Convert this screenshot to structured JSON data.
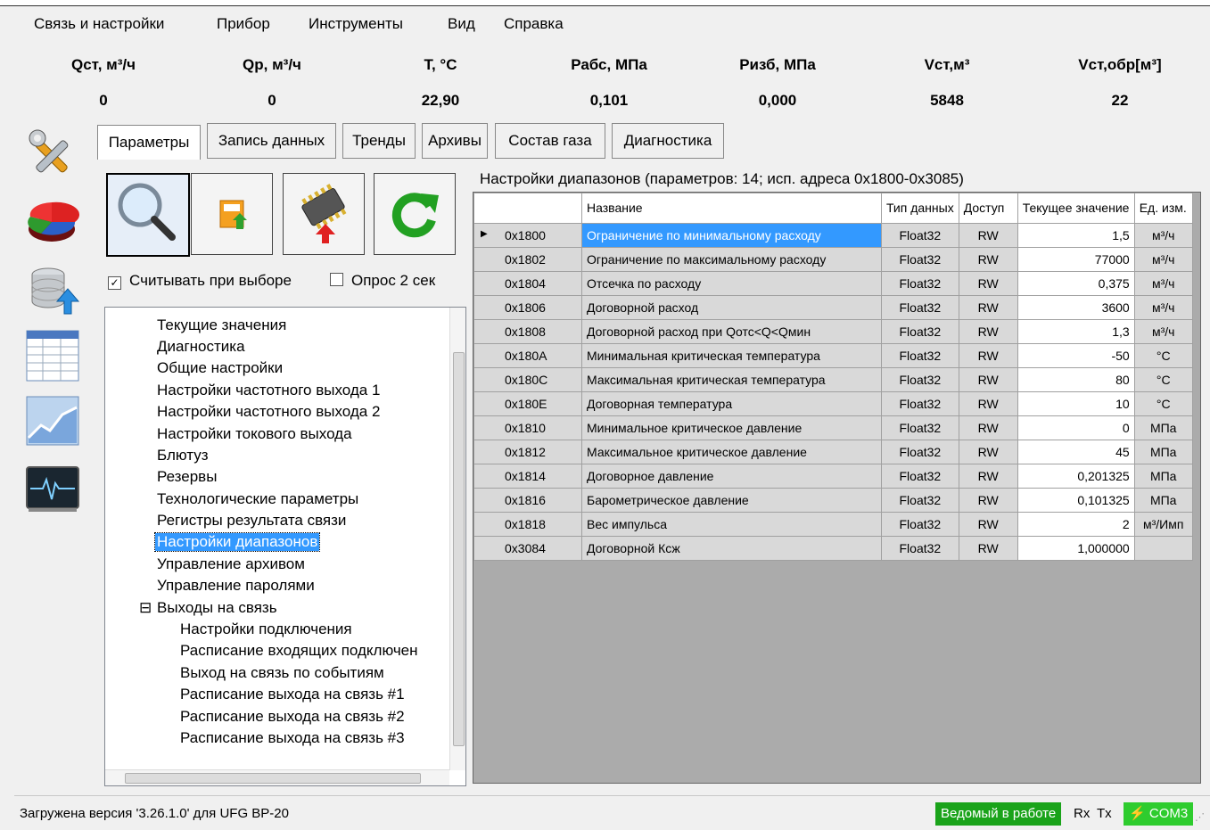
{
  "menu": [
    "Связь и настройки",
    "Прибор",
    "Инструменты",
    "Вид",
    "Справка"
  ],
  "readings": [
    {
      "label": "Qст, м³/ч",
      "value": "0"
    },
    {
      "label": "Qр, м³/ч",
      "value": "0"
    },
    {
      "label": "T, °C",
      "value": "22,90"
    },
    {
      "label": "Рабс, МПа",
      "value": "0,101"
    },
    {
      "label": "Ризб, МПа",
      "value": "0,000"
    },
    {
      "label": "Vст,м³",
      "value": "5848"
    },
    {
      "label": "Vст,обр[м³]",
      "value": "22"
    }
  ],
  "side_icons": [
    "tools-icon",
    "pie-chart-icon",
    "database-upload-icon",
    "table-icon",
    "line-chart-icon",
    "monitor-pulse-icon"
  ],
  "tabs": [
    "Параметры",
    "Запись данных",
    "Тренды",
    "Архивы",
    "Состав газа",
    "Диагностика"
  ],
  "toolbar": {
    "search": "search-icon",
    "save": "save-icon",
    "write_chip": "chip-write-icon",
    "refresh": "refresh-icon"
  },
  "checkboxes": {
    "read_on_select": {
      "label": "Считывать при выборе",
      "checked": true
    },
    "poll": {
      "label": "Опрос 2 сек",
      "checked": false
    }
  },
  "tree": [
    {
      "label": "Текущие значения",
      "level": 1
    },
    {
      "label": "Диагностика",
      "level": 1
    },
    {
      "label": "Общие настройки",
      "level": 1
    },
    {
      "label": "Настройки частотного выхода 1",
      "level": 1
    },
    {
      "label": "Настройки частотного выхода 2",
      "level": 1
    },
    {
      "label": "Настройки токового выхода",
      "level": 1
    },
    {
      "label": "Блютуз",
      "level": 1
    },
    {
      "label": "Резервы",
      "level": 1
    },
    {
      "label": "Технологические параметры",
      "level": 1
    },
    {
      "label": "Регистры результата связи",
      "level": 1
    },
    {
      "label": "Настройки диапазонов",
      "level": 1,
      "selected": true
    },
    {
      "label": "Управление архивом",
      "level": 1
    },
    {
      "label": "Управление паролями",
      "level": 1
    },
    {
      "label": "Выходы на связь",
      "level": 1,
      "expander": "⊟"
    },
    {
      "label": "Настройки подключения",
      "level": 2
    },
    {
      "label": "Расписание входящих подключен",
      "level": 2
    },
    {
      "label": "Выход на связь по событиям",
      "level": 2
    },
    {
      "label": "Расписание выхода на связь #1",
      "level": 2
    },
    {
      "label": "Расписание выхода на связь #2",
      "level": 2
    },
    {
      "label": "Расписание выхода на связь #3",
      "level": 2
    }
  ],
  "grid": {
    "title": "Настройки диапазонов (параметров: 14; исп. адреса 0x1800-0x3085)",
    "columns": [
      "",
      "Название",
      "Тип данных",
      "Доступ",
      "Текущее значение",
      "Ед. изм."
    ],
    "rows": [
      [
        "0x1800",
        "Ограничение по минимальному расходу",
        "Float32",
        "RW",
        "1,5",
        "м³/ч"
      ],
      [
        "0x1802",
        "Ограничение по максимальному расходу",
        "Float32",
        "RW",
        "77000",
        "м³/ч"
      ],
      [
        "0x1804",
        "Отсечка по расходу",
        "Float32",
        "RW",
        "0,375",
        "м³/ч"
      ],
      [
        "0x1806",
        "Договорной расход",
        "Float32",
        "RW",
        "3600",
        "м³/ч"
      ],
      [
        "0x1808",
        "Договорной расход при Qотс<Q<Qмин",
        "Float32",
        "RW",
        "1,3",
        "м³/ч"
      ],
      [
        "0x180A",
        "Минимальная критическая температура",
        "Float32",
        "RW",
        "-50",
        "°C"
      ],
      [
        "0x180C",
        "Максимальная критическая температура",
        "Float32",
        "RW",
        "80",
        "°C"
      ],
      [
        "0x180E",
        "Договорная температура",
        "Float32",
        "RW",
        "10",
        "°C"
      ],
      [
        "0x1810",
        "Минимальное критическое давление",
        "Float32",
        "RW",
        "0",
        "МПа"
      ],
      [
        "0x1812",
        "Максимальное критическое давление",
        "Float32",
        "RW",
        "45",
        "МПа"
      ],
      [
        "0x1814",
        "Договорное давление",
        "Float32",
        "RW",
        "0,201325",
        "МПа"
      ],
      [
        "0x1816",
        "Барометрическое давление",
        "Float32",
        "RW",
        "0,101325",
        "МПа"
      ],
      [
        "0x1818",
        "Вес импульса",
        "Float32",
        "RW",
        "2",
        "м³/Имп"
      ],
      [
        "0x3084",
        "Договорной Ксж",
        "Float32",
        "RW",
        "1,000000",
        ""
      ]
    ]
  },
  "status": {
    "text": "Загружена версия '3.26.1.0' для UFG BP-20",
    "mode": "Ведомый в работе",
    "rx": "Rx",
    "tx": "Tx",
    "port": "COM3",
    "mode_color": "#1aa31a",
    "port_color": "#2ecc2e"
  },
  "colors": {
    "selection": "#3399ff"
  }
}
